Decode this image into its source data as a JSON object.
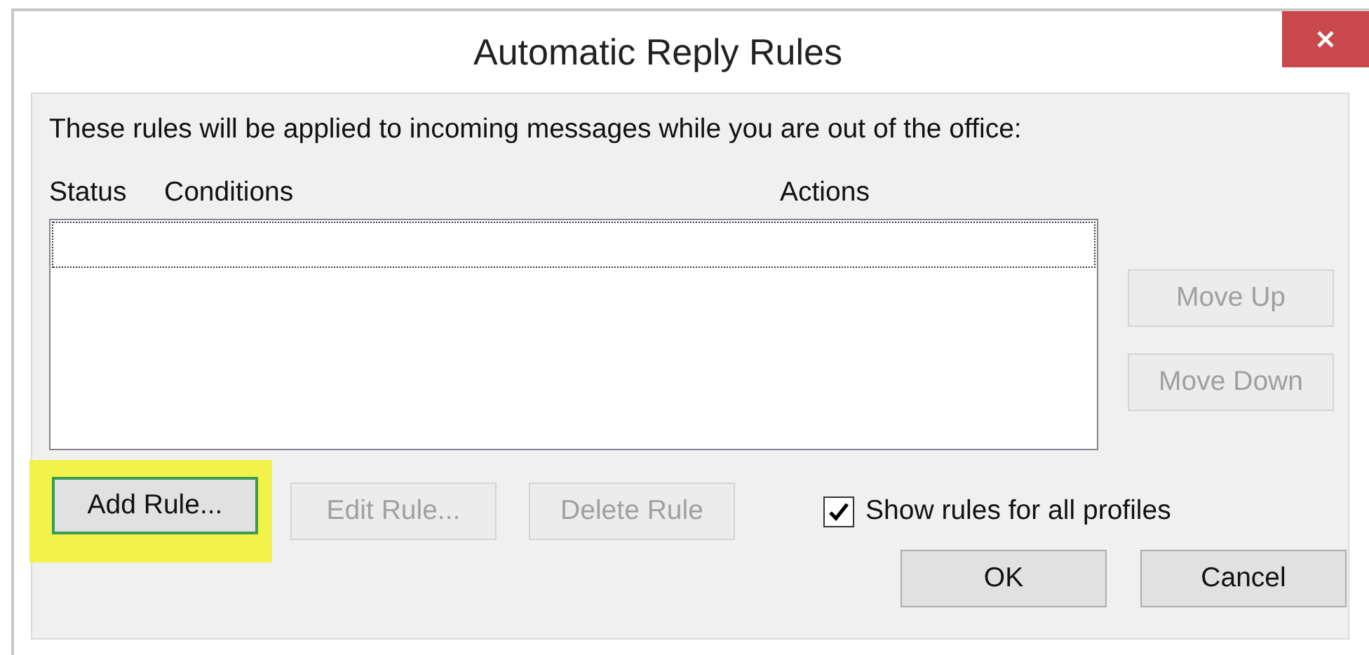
{
  "window": {
    "title": "Automatic Reply Rules"
  },
  "intro": "These rules will be applied to incoming messages while you are out of the office:",
  "list": {
    "columns": [
      "Status",
      "Conditions",
      "Actions"
    ],
    "focused": true
  },
  "side_buttons": [
    {
      "label": "Move Up",
      "disabled": true
    },
    {
      "label": "Move Down",
      "disabled": true
    }
  ],
  "rule_buttons": [
    {
      "label": "Add Rule...",
      "disabled": false,
      "focused": true,
      "highlighted": true
    },
    {
      "label": "Edit Rule...",
      "disabled": true,
      "focused": false,
      "highlighted": false
    },
    {
      "label": "Delete Rule",
      "disabled": true,
      "focused": false,
      "highlighted": false
    }
  ],
  "checkbox": {
    "label": "Show rules for all profiles",
    "checked": true
  },
  "dialog_buttons": [
    {
      "label": "OK"
    },
    {
      "label": "Cancel"
    }
  ]
}
